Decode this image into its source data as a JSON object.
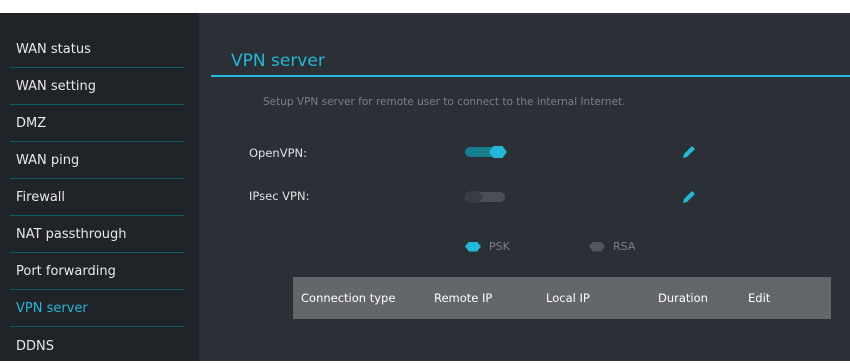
{
  "sidebar": {
    "items": [
      {
        "label": "WAN status"
      },
      {
        "label": "WAN setting"
      },
      {
        "label": "DMZ"
      },
      {
        "label": "WAN ping"
      },
      {
        "label": "Firewall"
      },
      {
        "label": "NAT passthrough"
      },
      {
        "label": "Port forwarding"
      },
      {
        "label": "VPN server",
        "active": true
      },
      {
        "label": "DDNS"
      }
    ]
  },
  "main": {
    "title": "VPN server",
    "description": "Setup VPN server for remote user to connect to the internal Internet.",
    "openvpn": {
      "label": "OpenVPN:",
      "enabled": true
    },
    "ipsec": {
      "label": "IPsec VPN:",
      "enabled": false
    },
    "auth_options": [
      {
        "label": "PSK",
        "selected": true
      },
      {
        "label": "RSA",
        "selected": false
      }
    ],
    "table": {
      "columns": [
        "Connection type",
        "Remote IP",
        "Local IP",
        "Duration",
        "Edit"
      ]
    }
  },
  "colors": {
    "accent": "#22b8d8",
    "sidebar_bg": "#202328",
    "main_bg": "#2b2f36",
    "table_header_bg": "#63666b"
  },
  "icons": {
    "edit": "pencil-icon"
  }
}
